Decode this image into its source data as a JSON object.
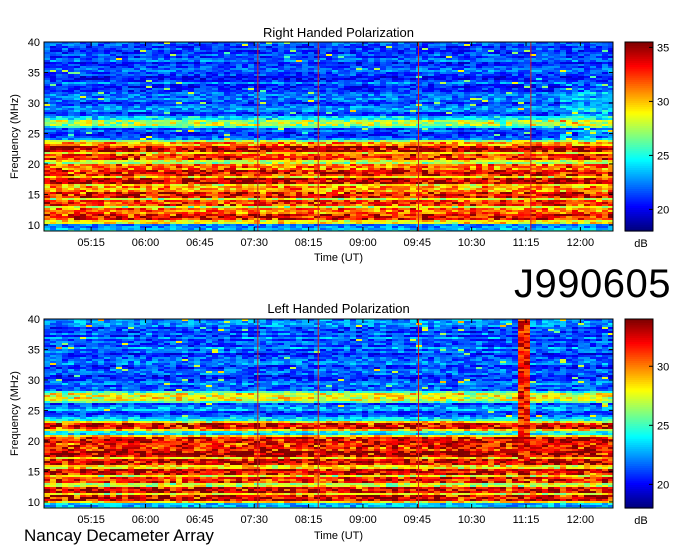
{
  "observation_id": "J990605",
  "instrument": "Nancay Decameter Array",
  "chart_data": [
    {
      "type": "heatmap",
      "title": "Right Handed Polarization",
      "xlabel": "Time (UT)",
      "ylabel": "Frequency (MHz)",
      "x_ticks": [
        "05:15",
        "06:00",
        "06:45",
        "07:30",
        "08:15",
        "09:00",
        "09:45",
        "10:30",
        "11:15",
        "12:00"
      ],
      "x_range": [
        "04:36",
        "12:27"
      ],
      "y_ticks": [
        10,
        15,
        20,
        25,
        30,
        35,
        40
      ],
      "ylim": [
        9,
        40
      ],
      "colorbar": {
        "label": "dB",
        "ticks": [
          20,
          25,
          30,
          35
        ],
        "range": [
          18,
          35.5
        ]
      },
      "marker_times": [
        "07:33",
        "08:23",
        "09:46",
        "11:19"
      ],
      "strong_bands_mhz": [
        {
          "f": 11.2,
          "level": 34
        },
        {
          "f": 12.3,
          "level": 32
        },
        {
          "f": 13.6,
          "level": 33
        },
        {
          "f": 15.0,
          "level": 34
        },
        {
          "f": 15.8,
          "level": 31
        },
        {
          "f": 17.2,
          "level": 35
        },
        {
          "f": 18.6,
          "level": 34
        },
        {
          "f": 19.6,
          "level": 32
        },
        {
          "f": 21.2,
          "level": 33
        },
        {
          "f": 22.5,
          "level": 35
        },
        {
          "f": 23.0,
          "level": 31
        },
        {
          "f": 26.8,
          "level": 28
        }
      ],
      "noise_floor_db": 22
    },
    {
      "type": "heatmap",
      "title": "Left Handed Polarization",
      "xlabel": "Time (UT)",
      "ylabel": "Frequency (MHz)",
      "x_ticks": [
        "05:15",
        "06:00",
        "06:45",
        "07:30",
        "08:15",
        "09:00",
        "09:45",
        "10:30",
        "11:15",
        "12:00"
      ],
      "x_range": [
        "04:36",
        "12:27"
      ],
      "y_ticks": [
        10,
        15,
        20,
        25,
        30,
        35,
        40
      ],
      "ylim": [
        9,
        40
      ],
      "colorbar": {
        "label": "dB",
        "ticks": [
          20,
          25,
          30
        ],
        "range": [
          18,
          34
        ]
      },
      "marker_times": [
        "07:33",
        "08:23",
        "09:46"
      ],
      "strong_bands_mhz": [
        {
          "f": 10.6,
          "level": 33
        },
        {
          "f": 12.0,
          "level": 33
        },
        {
          "f": 13.5,
          "level": 32
        },
        {
          "f": 14.8,
          "level": 33
        },
        {
          "f": 16.5,
          "level": 33
        },
        {
          "f": 17.8,
          "level": 34
        },
        {
          "f": 19.0,
          "level": 32
        },
        {
          "f": 20.2,
          "level": 33
        },
        {
          "f": 22.4,
          "level": 33
        },
        {
          "f": 27.2,
          "level": 28
        }
      ],
      "burst": {
        "time": "11:15",
        "f_range": [
          17,
          40
        ],
        "level": 34
      },
      "noise_floor_db": 22
    }
  ]
}
